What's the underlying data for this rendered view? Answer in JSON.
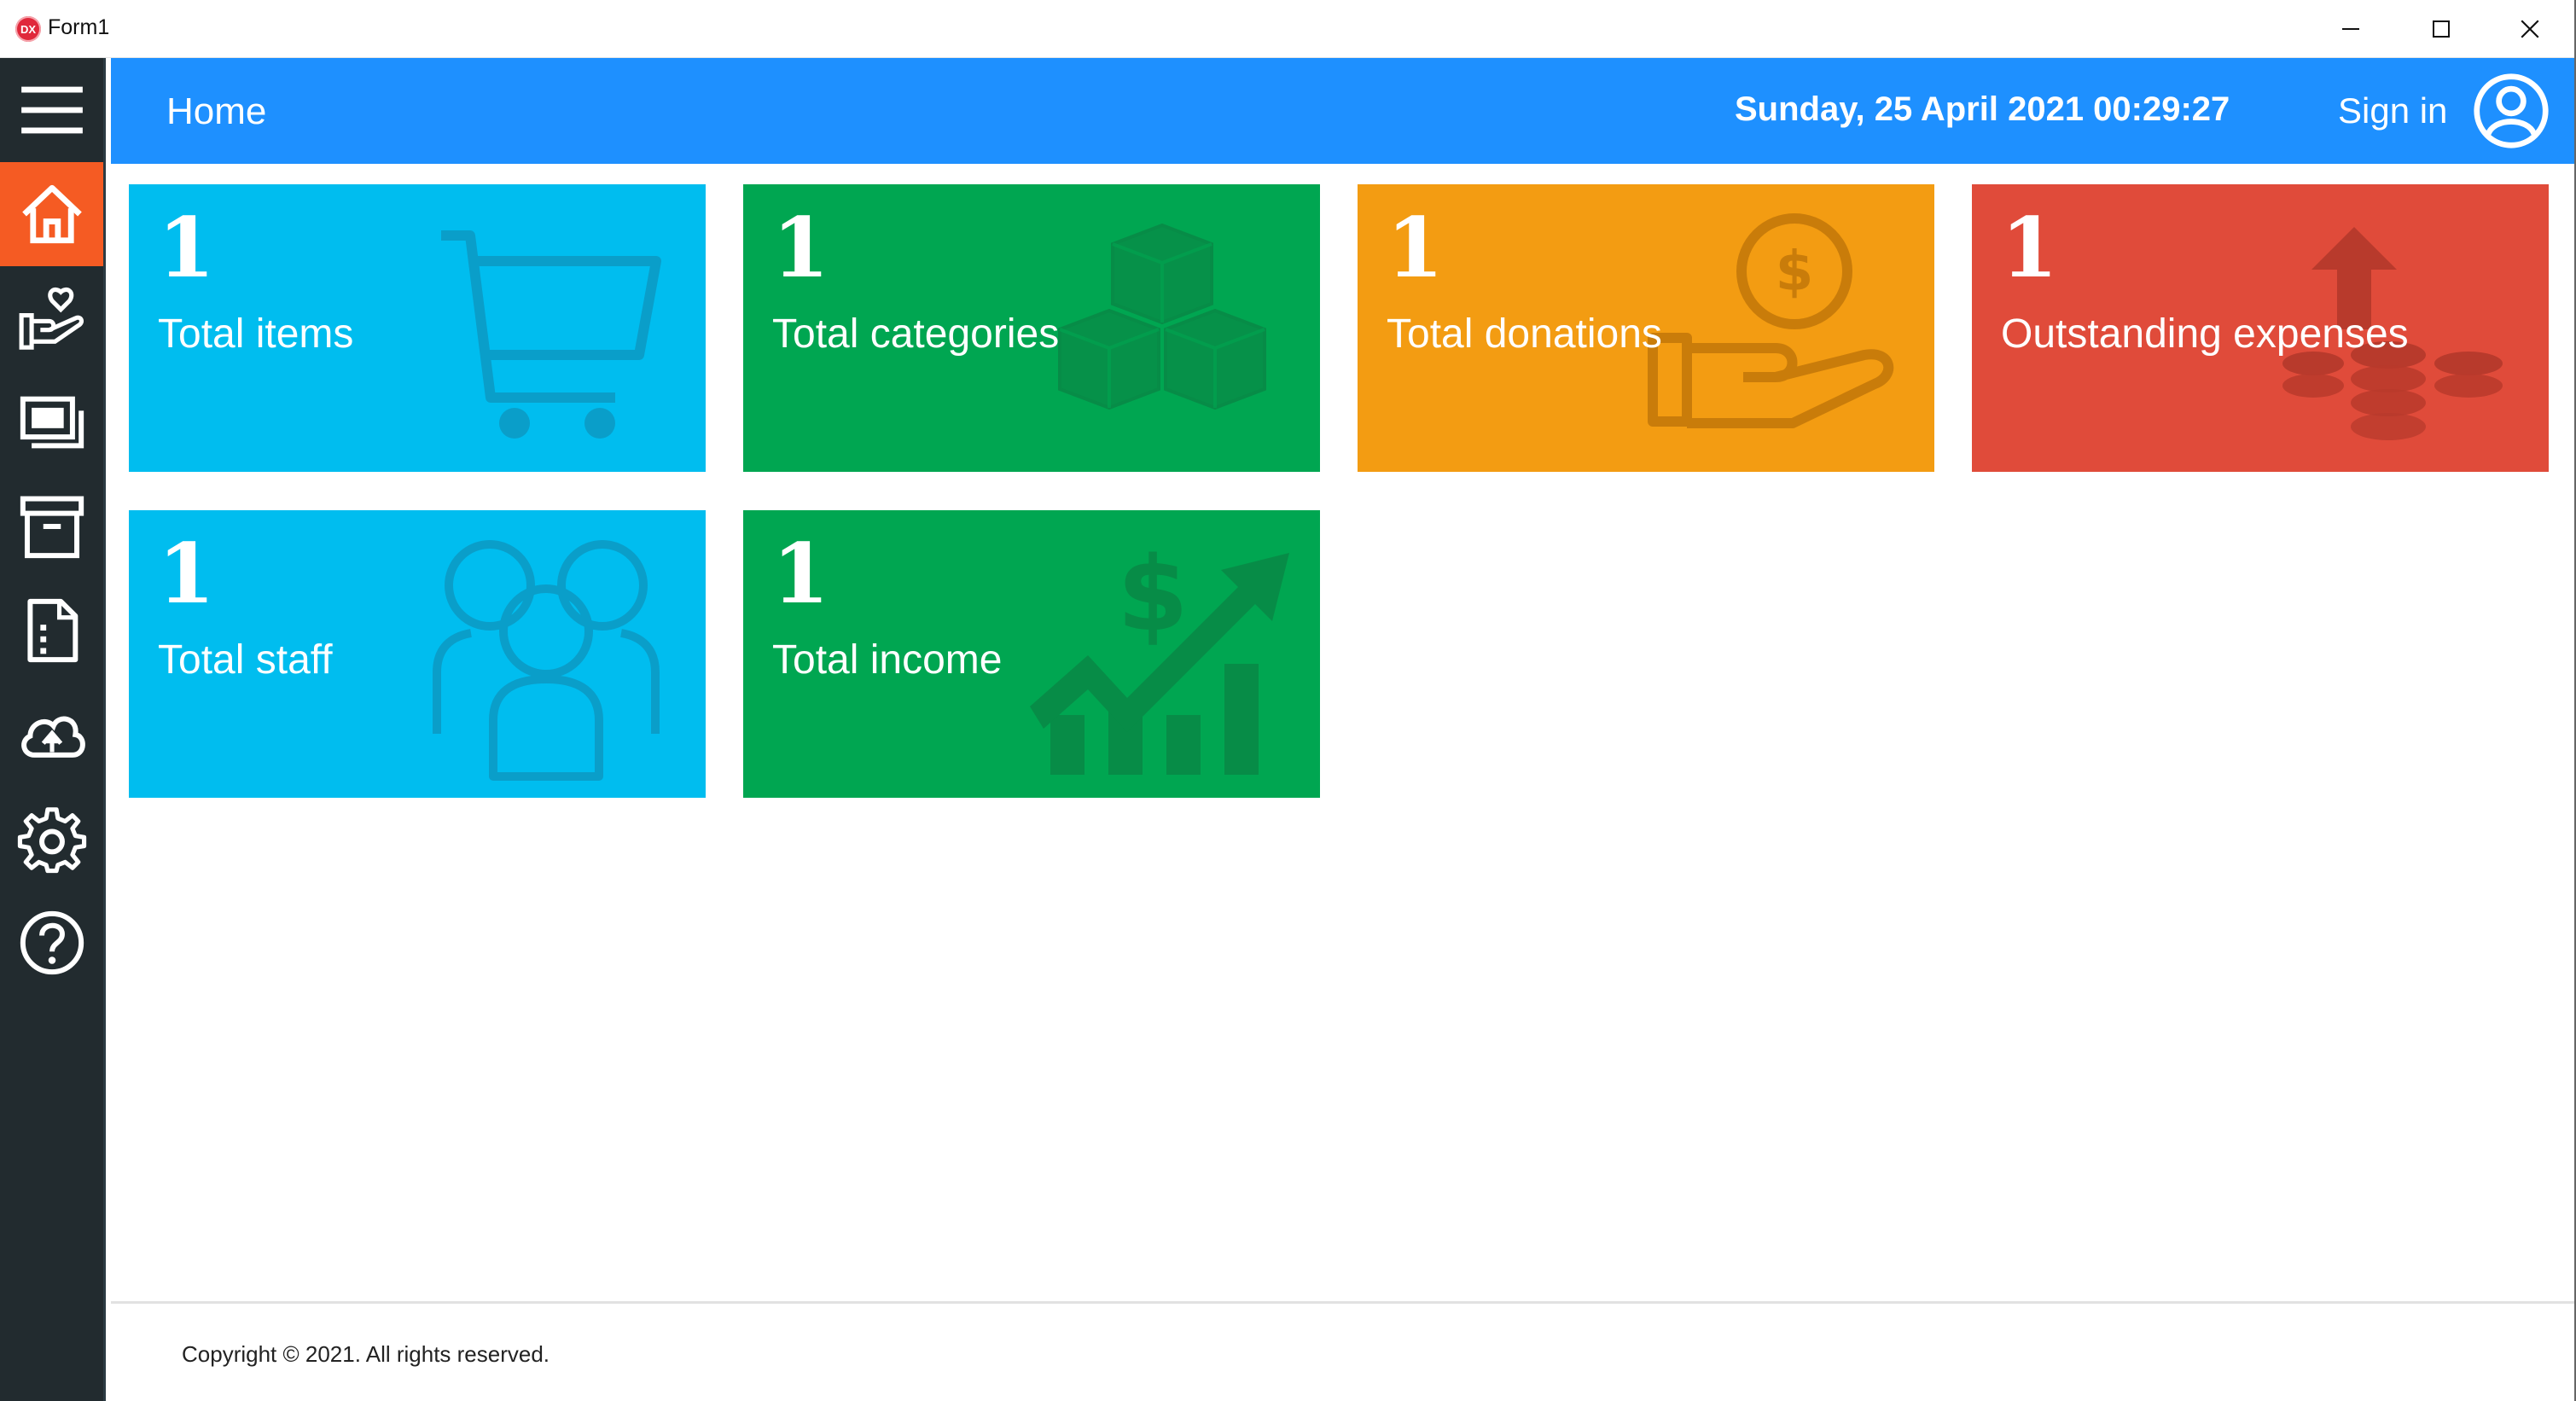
{
  "window": {
    "title": "Form1",
    "app_icon_text": "DX",
    "controls": [
      "minimize-icon",
      "maximize-icon",
      "close-icon"
    ]
  },
  "sidebar": {
    "items": [
      {
        "icon": "hamburger-menu-icon",
        "active": false
      },
      {
        "icon": "home-icon",
        "active": true
      },
      {
        "icon": "donation-hand-heart-icon",
        "active": false
      },
      {
        "icon": "cash-icon",
        "active": false
      },
      {
        "icon": "archive-box-icon",
        "active": false
      },
      {
        "icon": "document-icon",
        "active": false
      },
      {
        "icon": "cloud-upload-icon",
        "active": false
      },
      {
        "icon": "gear-icon",
        "active": false
      },
      {
        "icon": "help-icon",
        "active": false
      }
    ],
    "active_color": "#f55b23",
    "background": "#222b2f"
  },
  "header": {
    "title": "Home",
    "datetime": "Sunday, 25 April 2021 00:29:27",
    "signin_label": "Sign in",
    "background": "#1e90ff"
  },
  "tiles": [
    {
      "count": "1",
      "label": "Total items",
      "color": "#00bdef",
      "icon": "shopping-cart-icon"
    },
    {
      "count": "1",
      "label": "Total categories",
      "color": "#00a651",
      "icon": "boxes-icon"
    },
    {
      "count": "1",
      "label": "Total donations",
      "color": "#f39c12",
      "icon": "hand-coin-icon"
    },
    {
      "count": "1",
      "label": "Outstanding expenses",
      "color": "#e04b3a",
      "icon": "coins-arrow-up-icon"
    },
    {
      "count": "1",
      "label": "Total staff",
      "color": "#00bdef",
      "icon": "people-group-icon"
    },
    {
      "count": "1",
      "label": "Total income",
      "color": "#00a651",
      "icon": "growth-chart-icon"
    }
  ],
  "footer": {
    "copyright": "Copyright © 2021. All rights reserved."
  }
}
